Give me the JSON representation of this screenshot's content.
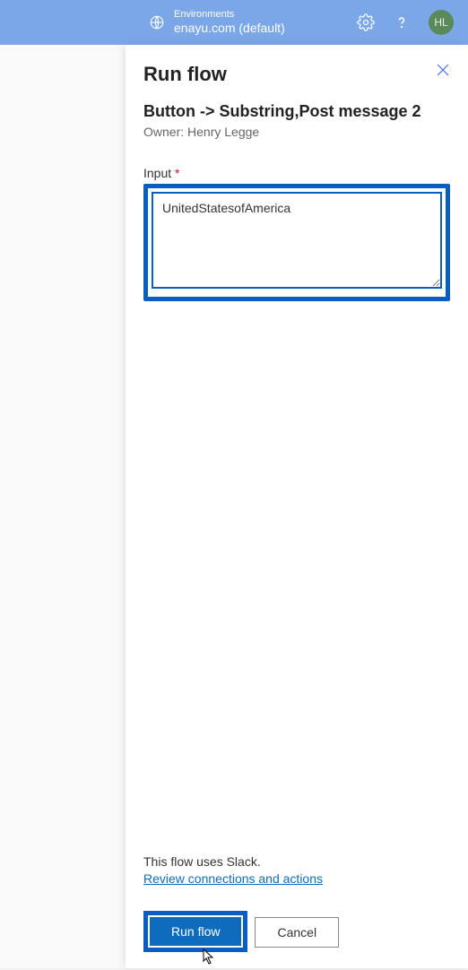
{
  "header": {
    "env_label": "Environments",
    "env_value": "enayu.com (default)",
    "avatar_initials": "HL"
  },
  "panel": {
    "title": "Run flow",
    "flow_name": "Button -> Substring,Post message 2",
    "owner": "Owner: Henry Legge",
    "input_label": "Input",
    "input_value": "UnitedStatesofAmerica",
    "footer_info": "This flow uses Slack.",
    "review_link": "Review connections and actions",
    "run_button": "Run flow",
    "cancel_button": "Cancel"
  }
}
